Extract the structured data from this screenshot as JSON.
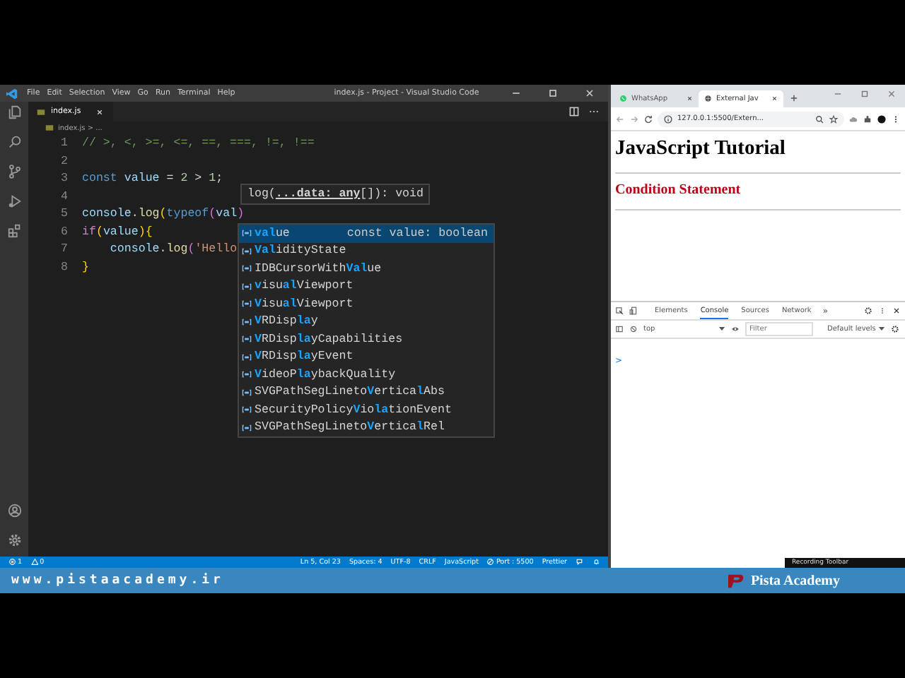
{
  "vscode": {
    "menu": [
      "File",
      "Edit",
      "Selection",
      "View",
      "Go",
      "Run",
      "Terminal",
      "Help"
    ],
    "title": "index.js - Project - Visual Studio Code",
    "tabs": [
      {
        "label": "index.js",
        "selected": true
      }
    ],
    "breadcrumb": "index.js > ...",
    "lines": [
      {
        "number": "1",
        "tokens": [
          {
            "text": "// >, <, >=, <=, ==, ===, !=, !==",
            "kind": "comment"
          }
        ]
      },
      {
        "number": "2"
      },
      {
        "number": "3",
        "tokens": [
          {
            "text": "const",
            "kind": "keyword"
          },
          {
            "text": " value",
            "kind": "variable"
          },
          {
            "text": " = ",
            "kind": "plain"
          },
          {
            "text": "2",
            "kind": "number"
          },
          {
            "text": " > ",
            "kind": "plain"
          },
          {
            "text": "1",
            "kind": "number"
          },
          {
            "text": ";",
            "kind": "plain"
          }
        ]
      },
      {
        "number": "4"
      },
      {
        "number": "5",
        "tokens": [
          {
            "text": "console",
            "kind": "variable"
          },
          {
            "text": ".",
            "kind": "plain"
          },
          {
            "text": "log",
            "kind": "function"
          },
          {
            "text": "(",
            "kind": "bracket"
          },
          {
            "text": "typeof",
            "kind": "keyword"
          },
          {
            "text": "(",
            "kind": "bracket2"
          },
          {
            "text": "val",
            "kind": "variable"
          },
          {
            "text": ")",
            "kind": "bracket2"
          }
        ]
      },
      {
        "number": "6",
        "tokens": [
          {
            "text": "if",
            "kind": "control"
          },
          {
            "text": "(",
            "kind": "bracket"
          },
          {
            "text": "value",
            "kind": "variable"
          },
          {
            "text": ")",
            "kind": "bracket"
          },
          {
            "text": "{",
            "kind": "bracket"
          }
        ]
      },
      {
        "number": "7",
        "tokens": [
          {
            "text": "    console",
            "kind": "variable"
          },
          {
            "text": ".",
            "kind": "plain"
          },
          {
            "text": "log",
            "kind": "function"
          },
          {
            "text": "(",
            "kind": "bracket2"
          },
          {
            "text": "'Hello",
            "kind": "string"
          }
        ]
      },
      {
        "number": "8",
        "tokens": [
          {
            "text": "}",
            "kind": "bracket"
          }
        ]
      }
    ],
    "hover": "log(**...data: any**[]): void",
    "suggestions": [
      {
        "selected": true,
        "detail": "const value: boolean",
        "segments": [
          {
            "text": "val",
            "match": true
          },
          {
            "text": "ue",
            "match": false
          }
        ]
      },
      {
        "selected": false,
        "segments": [
          {
            "text": "Val",
            "match": true
          },
          {
            "text": "idityState",
            "match": false
          }
        ]
      },
      {
        "selected": false,
        "segments": [
          {
            "text": "IDBCursorWith",
            "match": false
          },
          {
            "text": "Val",
            "match": true
          },
          {
            "text": "ue",
            "match": false
          }
        ]
      },
      {
        "selected": false,
        "segments": [
          {
            "text": "v",
            "match": true
          },
          {
            "text": "isu",
            "match": false
          },
          {
            "text": "al",
            "match": true
          },
          {
            "text": "Viewport",
            "match": false
          }
        ]
      },
      {
        "selected": false,
        "segments": [
          {
            "text": "V",
            "match": true
          },
          {
            "text": "isu",
            "match": false
          },
          {
            "text": "al",
            "match": true
          },
          {
            "text": "Viewport",
            "match": false
          }
        ]
      },
      {
        "selected": false,
        "segments": [
          {
            "text": "V",
            "match": true
          },
          {
            "text": "RDisp",
            "match": false
          },
          {
            "text": "la",
            "match": true
          },
          {
            "text": "y",
            "match": false
          }
        ]
      },
      {
        "selected": false,
        "segments": [
          {
            "text": "V",
            "match": true
          },
          {
            "text": "RDisp",
            "match": false
          },
          {
            "text": "la",
            "match": true
          },
          {
            "text": "yCapabilities",
            "match": false
          }
        ]
      },
      {
        "selected": false,
        "segments": [
          {
            "text": "V",
            "match": true
          },
          {
            "text": "RDisp",
            "match": false
          },
          {
            "text": "la",
            "match": true
          },
          {
            "text": "yEvent",
            "match": false
          }
        ]
      },
      {
        "selected": false,
        "segments": [
          {
            "text": "V",
            "match": true
          },
          {
            "text": "ideoP",
            "match": false
          },
          {
            "text": "la",
            "match": true
          },
          {
            "text": "ybackQuality",
            "match": false
          }
        ]
      },
      {
        "selected": false,
        "segments": [
          {
            "text": "SVGPathSegLineto",
            "match": false
          },
          {
            "text": "V",
            "match": true
          },
          {
            "text": "ertica",
            "match": false
          },
          {
            "text": "l",
            "match": true
          },
          {
            "text": "Abs",
            "match": false
          }
        ]
      },
      {
        "selected": false,
        "segments": [
          {
            "text": "SecurityPolicy",
            "match": false
          },
          {
            "text": "V",
            "match": true
          },
          {
            "text": "io",
            "match": false
          },
          {
            "text": "la",
            "match": true
          },
          {
            "text": "tionEvent",
            "match": false
          }
        ]
      },
      {
        "selected": false,
        "segments": [
          {
            "text": "SVGPathSegLineto",
            "match": false
          },
          {
            "text": "V",
            "match": true
          },
          {
            "text": "ertica",
            "match": false
          },
          {
            "text": "l",
            "match": true
          },
          {
            "text": "Rel",
            "match": false
          }
        ]
      }
    ],
    "status_left": [
      {
        "kind": "error",
        "text": "1"
      },
      {
        "kind": "warning",
        "text": "0"
      }
    ],
    "status_right": [
      {
        "kind": "text",
        "text": "Ln 5, Col 23"
      },
      {
        "kind": "text",
        "text": "Spaces: 4"
      },
      {
        "kind": "text",
        "text": "UTF-8"
      },
      {
        "kind": "text",
        "text": "CRLF"
      },
      {
        "kind": "text",
        "text": "JavaScript"
      },
      {
        "kind": "port",
        "text": "Port : 5500"
      },
      {
        "kind": "text",
        "text": "Prettier"
      }
    ]
  },
  "browser": {
    "tabs": [
      {
        "label": "WhatsApp",
        "selected": false,
        "kind": "whatsapp"
      },
      {
        "label": "External Jav",
        "selected": true,
        "kind": "globe"
      }
    ],
    "address": "127.0.0.1:5500/Extern...",
    "heading": "JavaScript Tutorial",
    "subheading": "Condition Statement",
    "devtools": {
      "tabs": [
        {
          "label": "Elements",
          "selected": false
        },
        {
          "label": "Console",
          "selected": true
        },
        {
          "label": "Sources",
          "selected": false
        },
        {
          "label": "Network",
          "selected": false
        }
      ],
      "more": "»",
      "context": "top",
      "filter_placeholder": "Filter",
      "levels": "Default levels",
      "prompt": ">"
    }
  },
  "recording_toolbar": "Recording Toolbar",
  "banner": {
    "url": "www.pistaacademy.ir",
    "brand": "Pista Academy"
  }
}
